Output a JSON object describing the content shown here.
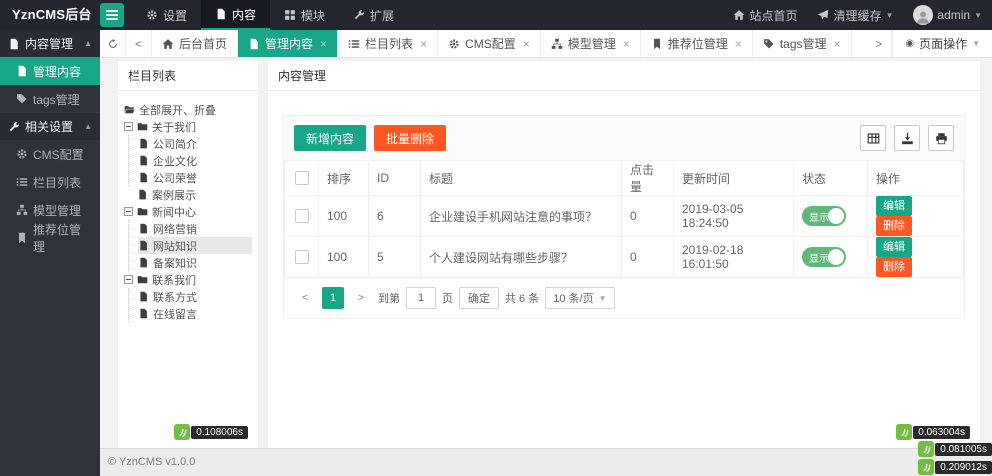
{
  "topbar": {
    "logo": "YznCMS后台",
    "menu": [
      {
        "label": "设置"
      },
      {
        "label": "内容"
      },
      {
        "label": "模块"
      },
      {
        "label": "扩展"
      }
    ],
    "site_home": "站点首页",
    "clear_cache": "清理缓存",
    "username": "admin"
  },
  "sidebar": {
    "groups": [
      {
        "label": "内容管理",
        "items": [
          {
            "label": "管理内容"
          },
          {
            "label": "tags管理"
          }
        ]
      },
      {
        "label": "相关设置",
        "items": [
          {
            "label": "CMS配置"
          },
          {
            "label": "栏目列表"
          },
          {
            "label": "模型管理"
          },
          {
            "label": "推荐位管理"
          }
        ]
      }
    ]
  },
  "tabbar": {
    "tabs": [
      {
        "label": "后台首页"
      },
      {
        "label": "管理内容"
      },
      {
        "label": "栏目列表"
      },
      {
        "label": "CMS配置"
      },
      {
        "label": "模型管理"
      },
      {
        "label": "推荐位管理"
      },
      {
        "label": "tags管理"
      }
    ],
    "close_glyph": "×",
    "page_ops": "页面操作"
  },
  "tree": {
    "title": "栏目列表",
    "toggle_all": "全部展开、折叠",
    "items": [
      {
        "label": "关于我们"
      },
      {
        "label": "公司简介"
      },
      {
        "label": "企业文化"
      },
      {
        "label": "公司荣誉"
      },
      {
        "label": "案例展示"
      },
      {
        "label": "新闻中心"
      },
      {
        "label": "网络营销"
      },
      {
        "label": "网站知识"
      },
      {
        "label": "备案知识"
      },
      {
        "label": "联系我们"
      },
      {
        "label": "联系方式"
      },
      {
        "label": "在线留言"
      }
    ],
    "trace_time": "0.108006s"
  },
  "main": {
    "title": "内容管理",
    "add_button": "新增内容",
    "batch_delete_button": "批量删除",
    "table": {
      "headers": {
        "sort": "排序",
        "id": "ID",
        "title": "标题",
        "clicks": "点击量",
        "updated": "更新时间",
        "status": "状态",
        "ops": "操作"
      },
      "rows": [
        {
          "sort": "100",
          "id": "6",
          "title": "企业建设手机网站注意的事项？",
          "clicks": "0",
          "updated": "2019-03-05 18:24:50",
          "status": "显示",
          "edit": "编辑",
          "del": "删除"
        },
        {
          "sort": "100",
          "id": "5",
          "title": "个人建设网站有哪些步骤？",
          "clicks": "0",
          "updated": "2019-02-18 16:01:50",
          "status": "显示",
          "edit": "编辑",
          "del": "删除"
        }
      ]
    },
    "pagination": {
      "prev": "<",
      "page": "1",
      "next": ">",
      "goto_label": "到第",
      "goto_value": "1",
      "page_unit": "页",
      "confirm": "确定",
      "total": "共 6 条",
      "per_page": "10 条/页"
    },
    "trace_time": "0.063004s"
  },
  "footer": {
    "copyright": "© YznCMS v1.0.0",
    "trace_time_1": "0.081005s",
    "trace_time_2": "0.209012s"
  },
  "colors": {
    "accent": "#18A689",
    "danger_orange": "#FF5722",
    "toggle_green": "#5FB878",
    "topbar_bg": "#23262F",
    "sidebar_bg": "#2F3238",
    "thinkphp_green": "#72BE45"
  }
}
